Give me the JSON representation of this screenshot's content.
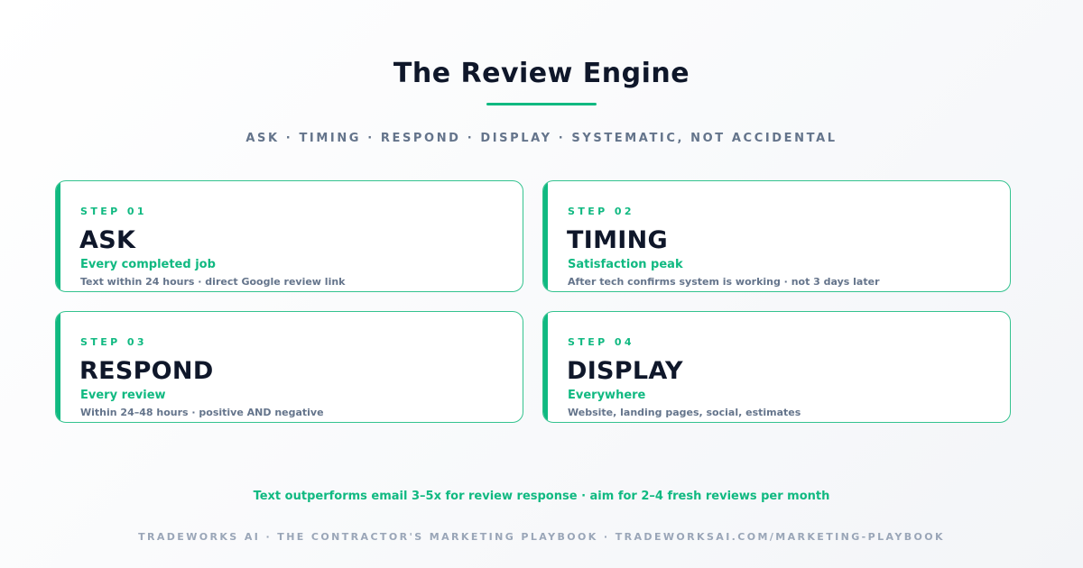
{
  "header": {
    "title": "The Review Engine",
    "subtitle": "ASK · TIMING · RESPOND · DISPLAY · SYSTEMATIC, NOT ACCIDENTAL"
  },
  "cards": [
    {
      "step": "STEP 01",
      "heading": "ASK",
      "highlight": "Every completed job",
      "detail": "Text within 24 hours · direct Google review link"
    },
    {
      "step": "STEP 02",
      "heading": "TIMING",
      "highlight": "Satisfaction peak",
      "detail": "After tech confirms system is working · not 3 days later"
    },
    {
      "step": "STEP 03",
      "heading": "RESPOND",
      "highlight": "Every review",
      "detail": "Within 24–48 hours · positive AND negative"
    },
    {
      "step": "STEP 04",
      "heading": "DISPLAY",
      "highlight": "Everywhere",
      "detail": "Website, landing pages, social, estimates"
    }
  ],
  "tagline": "Text outperforms email 3–5x for review response · aim for 2–4 fresh reviews per month",
  "footer": "TRADEWORKS AI · THE CONTRACTOR'S MARKETING PLAYBOOK · TRADEWORKSAI.COM/MARKETING-PLAYBOOK",
  "colors": {
    "accent": "#10b981",
    "heading": "#0f172a",
    "muted": "#64748b",
    "footer": "#9aa6b8",
    "card_border": "#34c38f"
  }
}
